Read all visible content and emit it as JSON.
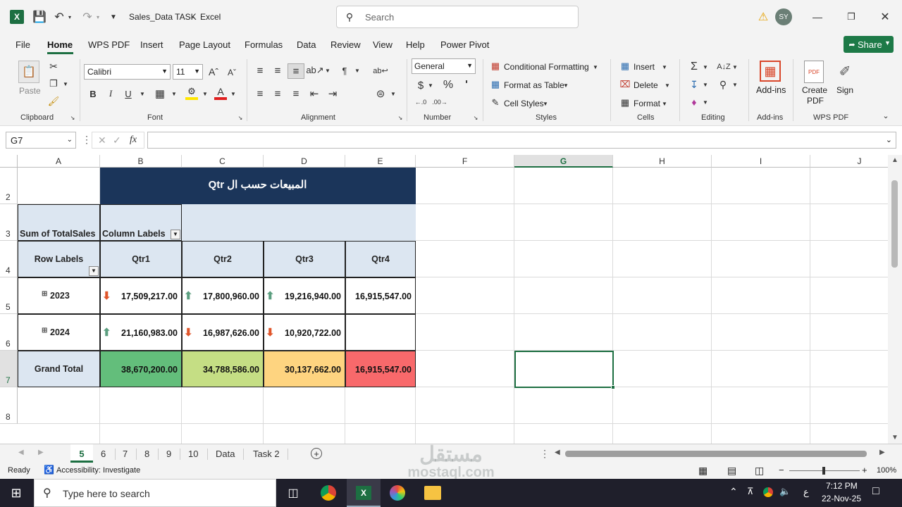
{
  "titlebar": {
    "filename": "Sales_Data TASK",
    "separator": "-",
    "app": "Excel",
    "search_placeholder": "Search",
    "user_initials": "SY"
  },
  "menu": [
    "File",
    "Home",
    "WPS PDF",
    "Insert",
    "Page Layout",
    "Formulas",
    "Data",
    "Review",
    "View",
    "Help",
    "Power Pivot"
  ],
  "share_label": "Share",
  "ribbon": {
    "clipboard": {
      "paste": "Paste",
      "label": "Clipboard"
    },
    "font": {
      "name": "Calibri",
      "size": "11",
      "label": "Font"
    },
    "alignment": {
      "label": "Alignment"
    },
    "number": {
      "format": "General",
      "label": "Number"
    },
    "styles": {
      "conditional": "Conditional Formatting",
      "format_table": "Format as Table",
      "cell_styles": "Cell Styles",
      "label": "Styles"
    },
    "cells": {
      "insert": "Insert",
      "delete": "Delete",
      "format": "Format",
      "label": "Cells"
    },
    "editing": {
      "label": "Editing"
    },
    "addins": {
      "button": "Add-ins",
      "label": "Add-ins"
    },
    "wps": {
      "create": "Create",
      "pdf": "PDF",
      "sign": "Sign",
      "label": "WPS PDF"
    }
  },
  "formula_bar": {
    "name_box": "G7",
    "fx": "fx",
    "value": ""
  },
  "columns": [
    "A",
    "B",
    "C",
    "D",
    "E",
    "F",
    "G",
    "H",
    "I",
    "J"
  ],
  "rows": [
    "2",
    "3",
    "4",
    "5",
    "6",
    "7",
    "8"
  ],
  "pivot": {
    "title": "المبيعات حسب ال Qtr",
    "sum_label": "Sum of TotalSales",
    "column_labels": "Column Labels",
    "row_labels": "Row Labels",
    "quarters": [
      "Qtr1",
      "Qtr2",
      "Qtr3",
      "Qtr4"
    ],
    "data_rows": [
      {
        "label": "2023",
        "values": [
          "17,509,217.00",
          "17,800,960.00",
          "19,216,940.00",
          "16,915,547.00"
        ],
        "arrows": [
          "down",
          "up",
          "up",
          "none"
        ]
      },
      {
        "label": "2024",
        "values": [
          "21,160,983.00",
          "16,987,626.00",
          "10,920,722.00",
          ""
        ],
        "arrows": [
          "up",
          "down",
          "down",
          "none"
        ]
      }
    ],
    "grand_total": {
      "label": "Grand Total",
      "values": [
        "38,670,200.00",
        "34,788,586.00",
        "30,137,662.00",
        "16,915,547.00"
      ]
    },
    "colors": {
      "title_bg": "#1b355a",
      "header_bg": "#dce6f1",
      "gt_bg": [
        "#63be7b",
        "#c5de84",
        "#fed480",
        "#f8696b"
      ],
      "arrow_up": "#5b9e7f",
      "arrow_down": "#e0552a"
    }
  },
  "sheet_tabs": [
    "5",
    "6",
    "7",
    "8",
    "9",
    "10",
    "Data",
    "Task 2"
  ],
  "active_tab": "5",
  "status": {
    "ready": "Ready",
    "accessibility": "Accessibility: Investigate",
    "zoom": "100%"
  },
  "watermark": {
    "arabic": "مستقل",
    "latin": "mostaql.com"
  },
  "taskbar": {
    "search_placeholder": "Type here to search",
    "lang": "ع",
    "time": "7:12 PM",
    "date": "22-Nov-25"
  }
}
